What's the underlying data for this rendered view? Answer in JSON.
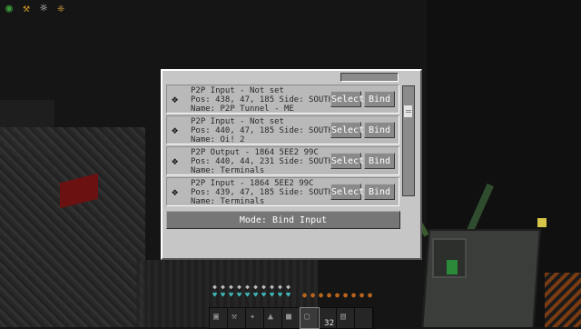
{
  "status_effects": [
    {
      "icon": "night-vision-icon",
      "glyph": "◉"
    },
    {
      "icon": "haste-icon",
      "glyph": "⚒"
    },
    {
      "icon": "regeneration-icon",
      "glyph": "☼"
    },
    {
      "icon": "resistance-icon",
      "glyph": "❈"
    }
  ],
  "gui": {
    "entries": [
      {
        "line1": "P2P Input - Not set",
        "line2": "Pos: 438, 47, 185 Side: SOUTH",
        "line3": "Name: P2P Tunnel - ME",
        "select_label": "Select",
        "bind_label": "Bind"
      },
      {
        "line1": "P2P Input - Not set",
        "line2": "Pos: 440, 47, 185 Side: SOUTH",
        "line3": "Name: Oi! 2",
        "select_label": "Select",
        "bind_label": "Bind"
      },
      {
        "line1": "P2P Output - 1864 5EE2 99C",
        "line2": "Pos: 440, 44, 231 Side: SOUTH",
        "line3": "Name: Terminals",
        "select_label": "Select",
        "bind_label": "Bind"
      },
      {
        "line1": "P2P Input - 1864 5EE2 99C",
        "line2": "Pos: 439, 47, 185 Side: SOUTH",
        "line3": "Name: Terminals",
        "select_label": "Select",
        "bind_label": "Bind"
      }
    ],
    "mode_label": "Mode: Bind Input"
  },
  "hud": {
    "hotbar_count": "32"
  }
}
